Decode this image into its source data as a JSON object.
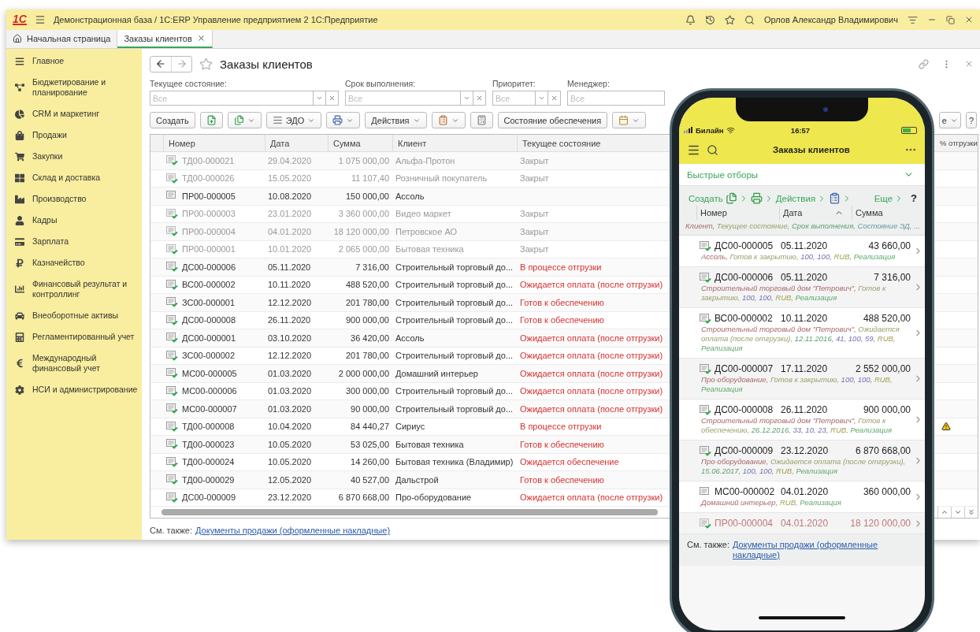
{
  "title_bar": {
    "logo": "1С",
    "title": "Демонстрационная база / 1С:ERP Управление предприятием 2 1С:Предприятие",
    "user": "Орлов Александр Владимирович"
  },
  "tabs": [
    {
      "label": "Начальная страница",
      "kind": "home",
      "selected": false
    },
    {
      "label": "Заказы клиентов",
      "kind": "document",
      "selected": true
    }
  ],
  "sidebar": {
    "items": [
      {
        "label": "Главное"
      },
      {
        "label": "Бюджетирование и планирование"
      },
      {
        "label": "CRM и маркетинг"
      },
      {
        "label": "Продажи"
      },
      {
        "label": "Закупки"
      },
      {
        "label": "Склад и доставка"
      },
      {
        "label": "Производство"
      },
      {
        "label": "Кадры"
      },
      {
        "label": "Зарплата"
      },
      {
        "label": "Казначейство"
      },
      {
        "label": "Финансовый результат и контроллинг"
      },
      {
        "label": "Внеоборотные активы"
      },
      {
        "label": "Регламентированный учет"
      },
      {
        "label": "Международный финансовый учет"
      },
      {
        "label": "НСИ и администрирование"
      }
    ]
  },
  "form": {
    "title": "Заказы клиентов",
    "filters": [
      {
        "label": "Текущее состояние:",
        "placeholder": "Все"
      },
      {
        "label": "Срок выполнения:",
        "placeholder": "Все"
      },
      {
        "label": "Приоритет:",
        "placeholder": "Все"
      },
      {
        "label": "Менеджер:",
        "placeholder": "Все"
      }
    ],
    "toolbar": [
      {
        "kind": "text",
        "label": "Создать",
        "caret": false
      },
      {
        "kind": "icon",
        "caret": false
      },
      {
        "kind": "icon",
        "caret": true
      },
      {
        "kind": "icon_text",
        "label": "ЭДО",
        "caret": true
      },
      {
        "kind": "icon",
        "caret": true
      },
      {
        "kind": "text",
        "label": "Действия",
        "caret": true
      },
      {
        "kind": "icon",
        "caret": true
      },
      {
        "kind": "icon",
        "caret": false
      },
      {
        "kind": "text",
        "label": "Состояние обеспечения",
        "caret": false
      },
      {
        "kind": "icon",
        "caret": true
      }
    ],
    "toolbar_right": [
      {
        "kind": "text",
        "label": "е",
        "caret": true
      },
      {
        "kind": "text",
        "label": "?",
        "caret": false
      }
    ],
    "table": {
      "columns": [
        "Номер",
        "Дата",
        "Сумма",
        "Клиент",
        "Текущее состояние",
        "% отгрузки"
      ],
      "rows": [
        {
          "number": "ТД00-000021",
          "date": "29.04.2020",
          "sum": "1 075 000,00",
          "client": "Альфа-Протон",
          "status": "Закрыт",
          "closed": true,
          "posted": true,
          "alert": false
        },
        {
          "number": "ТД00-000026",
          "date": "15.05.2020",
          "sum": "11 107,40",
          "client": "Розничный покупатель",
          "status": "Закрыт",
          "closed": true,
          "posted": true,
          "alert": false
        },
        {
          "number": "ПР00-000005",
          "date": "10.08.2020",
          "sum": "150 000,00",
          "client": "Ассоль",
          "closed": false,
          "posted": false,
          "alert": false
        },
        {
          "number": "ПР00-000003",
          "date": "23.01.2020",
          "sum": "3 360 000,00",
          "client": "Видео маркет",
          "status": "Закрыт",
          "closed": true,
          "posted": true,
          "alert": false
        },
        {
          "number": "ПР00-000004",
          "date": "04.01.2020",
          "sum": "18 120 000,00",
          "client": "Петровское АО",
          "status": "Закрыт",
          "closed": true,
          "posted": true,
          "alert": false
        },
        {
          "number": "ПР00-000001",
          "date": "10.01.2020",
          "sum": "2 065 000,00",
          "client": "Бытовая техника",
          "status": "Закрыт",
          "closed": true,
          "posted": true,
          "alert": false
        },
        {
          "number": "ДС00-000006",
          "date": "05.11.2020",
          "sum": "7 316,00",
          "client": "Строительный торговый до...",
          "status": "В процессе отгрузки",
          "closed": false,
          "posted": true,
          "alert": false
        },
        {
          "number": "ВС00-000002",
          "date": "10.11.2020",
          "sum": "488 520,00",
          "client": "Строительный торговый до...",
          "status": "Ожидается оплата (после отгрузки)",
          "closed": false,
          "posted": true,
          "alert": false
        },
        {
          "number": "ЗС00-000001",
          "date": "12.12.2020",
          "sum": "201 780,00",
          "client": "Строительный торговый до...",
          "status": "Готов к обеспечению",
          "closed": false,
          "posted": true,
          "alert": false
        },
        {
          "number": "ДС00-000008",
          "date": "26.11.2020",
          "sum": "900 000,00",
          "client": "Строительный торговый до...",
          "status": "Готов к обеспечению",
          "closed": false,
          "posted": true,
          "alert": false
        },
        {
          "number": "ДС00-000001",
          "date": "03.10.2020",
          "sum": "36 420,00",
          "client": "Ассоль",
          "status": "Ожидается оплата (после отгрузки)",
          "closed": false,
          "posted": true,
          "alert": false
        },
        {
          "number": "ЗС00-000002",
          "date": "12.12.2020",
          "sum": "201 780,00",
          "client": "Строительный торговый до...",
          "status": "Ожидается оплата (после отгрузки)",
          "closed": false,
          "posted": true,
          "alert": false
        },
        {
          "number": "МС00-000005",
          "date": "01.03.2020",
          "sum": "2 000 000,00",
          "client": "Домашний интерьер",
          "status": "Ожидается оплата (после отгрузки)",
          "closed": false,
          "posted": true,
          "alert": false
        },
        {
          "number": "МС00-000006",
          "date": "01.03.2020",
          "sum": "300 000,00",
          "client": "Строительный торговый до...",
          "status": "Ожидается оплата (после отгрузки)",
          "closed": false,
          "posted": true,
          "alert": false
        },
        {
          "number": "МС00-000007",
          "date": "01.03.2020",
          "sum": "90 000,00",
          "client": "Строительный торговый до...",
          "status": "Ожидается оплата (после отгрузки)",
          "closed": false,
          "posted": true,
          "alert": false
        },
        {
          "number": "ТД00-000008",
          "date": "10.04.2020",
          "sum": "84 440,27",
          "client": "Сириус",
          "status": "В процессе отгрузки",
          "closed": false,
          "posted": true,
          "alert": true
        },
        {
          "number": "ТД00-000023",
          "date": "10.05.2020",
          "sum": "53 025,00",
          "client": "Бытовая техника",
          "status": "Готов к обеспечению",
          "closed": false,
          "posted": true,
          "alert": false
        },
        {
          "number": "ТД00-000024",
          "date": "10.05.2020",
          "sum": "14 260,00",
          "client": "Бытовая техника (Владимир)",
          "status": "Ожидается обеспечение",
          "closed": false,
          "posted": true,
          "alert": false
        },
        {
          "number": "ТД00-000029",
          "date": "12.05.2020",
          "sum": "40 527,00",
          "client": "Дальстрой",
          "status": "Готов к обеспечению",
          "closed": false,
          "posted": true,
          "alert": false
        },
        {
          "number": "ДС00-000009",
          "date": "23.12.2020",
          "sum": "6 870 668,00",
          "client": "Про-оборудование",
          "status": "Ожидается оплата (после отгрузки)",
          "closed": false,
          "posted": true,
          "alert": false
        }
      ]
    },
    "see_also": {
      "label": "См. также:",
      "link": "Документы продажи (оформленные накладные)"
    }
  },
  "phone": {
    "carrier": "Билайн",
    "time": "16:57",
    "title": "Заказы клиентов",
    "quick_filters": "Быстрые отборы",
    "toolbar": [
      {
        "kind": "text",
        "label": "Создать",
        "caret": false
      },
      {
        "kind": "icon",
        "caret": true
      },
      {
        "kind": "icon",
        "caret": true
      },
      {
        "kind": "text",
        "label": "Действия",
        "caret": true
      },
      {
        "kind": "icon",
        "caret": true
      }
    ],
    "more": "Еще",
    "help": "?",
    "columns": [
      {
        "label": "Номер",
        "sorted": false
      },
      {
        "label": "Дата",
        "sorted": true
      },
      {
        "label": "Сумма",
        "sorted": false
      }
    ],
    "column_hint": [
      {
        "text": "Клиент,",
        "kind": "client"
      },
      {
        "text": "Текущее состояние,",
        "kind": "state"
      },
      {
        "text": "Срок выполнения,",
        "kind": "date"
      },
      {
        "text": "Состояние ЭД, ...",
        "kind": "edi"
      }
    ],
    "items": [
      {
        "number": "ДС00-000005",
        "date": "05.11.2020",
        "sum": "43 660,00",
        "posted": true,
        "closed": false,
        "details": [
          {
            "text": "Ассоль,",
            "kind": "client"
          },
          {
            "text": "Готов к закрытию,",
            "kind": "state"
          },
          {
            "text": "100,",
            "kind": "value"
          },
          {
            "text": "100,",
            "kind": "value"
          },
          {
            "text": "RUB,",
            "kind": "currency"
          },
          {
            "text": "Реализация",
            "kind": "operation"
          }
        ]
      },
      {
        "number": "ДС00-000006",
        "date": "05.11.2020",
        "sum": "7 316,00",
        "posted": true,
        "closed": false,
        "details": [
          {
            "text": "Строительный торговый дом \"Петрович\",",
            "kind": "client"
          },
          {
            "text": "Готов к закрытию,",
            "kind": "state"
          },
          {
            "text": "100,",
            "kind": "value"
          },
          {
            "text": "100,",
            "kind": "value"
          },
          {
            "text": "RUB,",
            "kind": "currency"
          },
          {
            "text": "Реализация",
            "kind": "operation"
          }
        ]
      },
      {
        "number": "ВС00-000002",
        "date": "10.11.2020",
        "sum": "488 520,00",
        "posted": true,
        "closed": false,
        "details": [
          {
            "text": "Строительный торговый дом \"Петрович\",",
            "kind": "client"
          },
          {
            "text": "Ожидается оплата (после отгрузки),",
            "kind": "state"
          },
          {
            "text": "12.11.2016,",
            "kind": "date"
          },
          {
            "text": "41,",
            "kind": "value"
          },
          {
            "text": "100,",
            "kind": "value"
          },
          {
            "text": "59,",
            "kind": "value"
          },
          {
            "text": "RUB,",
            "kind": "currency"
          },
          {
            "text": "Реализация",
            "kind": "operation"
          }
        ]
      },
      {
        "number": "ДС00-000007",
        "date": "17.11.2020",
        "sum": "2 552 000,00",
        "posted": true,
        "closed": false,
        "details": [
          {
            "text": "Про-оборудование,",
            "kind": "client"
          },
          {
            "text": "Готов к закрытию,",
            "kind": "state"
          },
          {
            "text": "100,",
            "kind": "value"
          },
          {
            "text": "100,",
            "kind": "value"
          },
          {
            "text": "RUB,",
            "kind": "currency"
          },
          {
            "text": "Реализация",
            "kind": "operation"
          }
        ]
      },
      {
        "number": "ДС00-000008",
        "date": "26.11.2020",
        "sum": "900 000,00",
        "posted": true,
        "closed": false,
        "details": [
          {
            "text": "Строительный торговый дом \"Петрович\",",
            "kind": "client"
          },
          {
            "text": "Готов к обеспечению,",
            "kind": "state"
          },
          {
            "text": "26.12.2016,",
            "kind": "date"
          },
          {
            "text": "33,",
            "kind": "value"
          },
          {
            "text": "10,",
            "kind": "value"
          },
          {
            "text": "23,",
            "kind": "value"
          },
          {
            "text": "RUB,",
            "kind": "currency"
          },
          {
            "text": "Реализация",
            "kind": "operation"
          }
        ]
      },
      {
        "number": "ДС00-000009",
        "date": "23.12.2020",
        "sum": "6 870 668,00",
        "posted": true,
        "closed": false,
        "details": [
          {
            "text": "Про-оборудование,",
            "kind": "client"
          },
          {
            "text": "Ожидается оплата (после отгрузки),",
            "kind": "state"
          },
          {
            "text": "15.06.2017,",
            "kind": "date"
          },
          {
            "text": "100,",
            "kind": "value"
          },
          {
            "text": "100,",
            "kind": "value"
          },
          {
            "text": "RUB,",
            "kind": "currency"
          },
          {
            "text": "Реализация",
            "kind": "operation"
          }
        ]
      },
      {
        "number": "МС00-000002",
        "date": "04.01.2020",
        "sum": "360 000,00",
        "posted": false,
        "closed": false,
        "details": [
          {
            "text": "Домашний интерьер,",
            "kind": "client"
          },
          {
            "text": "RUB,",
            "kind": "currency"
          },
          {
            "text": "Реализация",
            "kind": "operation"
          }
        ]
      },
      {
        "number": "ПР00-000004",
        "date": "04.01.2020",
        "sum": "18 120 000,00",
        "posted": true,
        "closed": true
      }
    ],
    "see_also": {
      "label": "См. также:",
      "link": "Документы продажи (оформленные накладные)"
    }
  }
}
